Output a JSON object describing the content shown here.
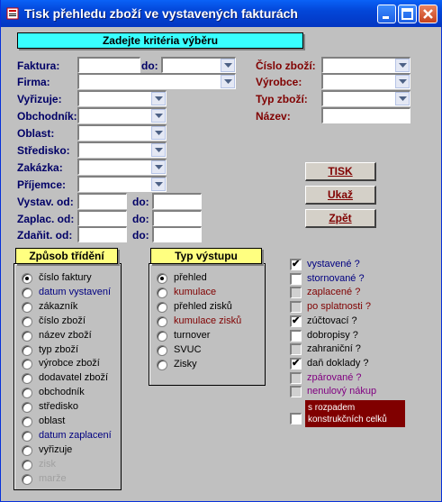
{
  "window": {
    "title": "Tisk přehledu zboží ve vystavených fakturách"
  },
  "header": {
    "title": "Zadejte kritéria výběru"
  },
  "labels": {
    "faktura": "Faktura:",
    "do": "do:",
    "firma": "Firma:",
    "vyrizuje": "Vyřizuje:",
    "obchodnik": "Obchodník:",
    "oblast": "Oblast:",
    "stredisko": "Středisko:",
    "zakazka": "Zakázka:",
    "prijemce": "Příjemce:",
    "vystav_od": "Vystav. od:",
    "zaplac_od": "Zaplac. od:",
    "zdanit_od": "Zdaňit. od:",
    "cislo_zbozi": "Číslo zboží:",
    "vyrobce": "Výrobce:",
    "typ_zbozi": "Typ zboží:",
    "nazev": "Název:"
  },
  "buttons": {
    "tisk": "TISK",
    "ukaz": "Ukaž",
    "zpet": "Zpět"
  },
  "sort": {
    "title": "Způsob třídění",
    "options": [
      "číslo faktury",
      "datum vystavení",
      "zákazník",
      "číslo zboží",
      "název zboží",
      "typ zboží",
      "výrobce zboží",
      "dodavatel zboží",
      "obchodník",
      "středisko",
      "oblast",
      "datum zaplacení",
      "vyřizuje",
      "zisk",
      "marže"
    ],
    "colors": [
      "#000000",
      "#000080",
      "#000000",
      "#000000",
      "#000000",
      "#000000",
      "#000000",
      "#000000",
      "#000000",
      "#000000",
      "#000000",
      "#000080",
      "#000000",
      "#a0a0a0",
      "#a0a0a0"
    ],
    "selected": 0
  },
  "output": {
    "title": "Typ výstupu",
    "options": [
      "přehled",
      "kumulace",
      "přehled zisků",
      "kumulace zisků",
      "turnover",
      "SVUC",
      "Zisky"
    ],
    "colors": [
      "#000000",
      "#800000",
      "#000000",
      "#800000",
      "#000000",
      "#000000",
      "#000000"
    ],
    "selected": 0
  },
  "flags": {
    "items": [
      "vystavené ?",
      "stornované ?",
      "zaplacené ?",
      "po splatnosti ?",
      "zúčtovací ?",
      "dobropisy ?",
      "zahraniční ?",
      "daň doklady ?",
      "zpárované ?",
      "nenulový nákup"
    ],
    "colors": [
      "#000080",
      "#000080",
      "#800000",
      "#800000",
      "#000000",
      "#000000",
      "#000000",
      "#000000",
      "#800080",
      "#800080"
    ],
    "states": [
      "checked",
      "unchecked",
      "grey",
      "grey",
      "checked",
      "unchecked",
      "grey",
      "checked",
      "grey",
      "grey"
    ],
    "last": "s rozpadem konstrukčních celků"
  }
}
